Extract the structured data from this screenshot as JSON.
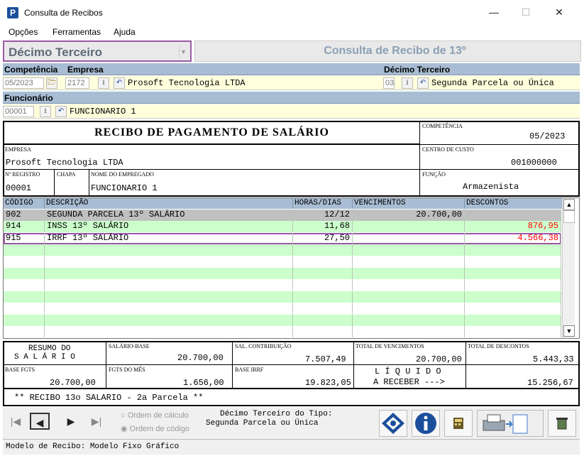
{
  "window": {
    "title": "Consulta de Recibos",
    "app_icon": "P",
    "minimize": "—",
    "maximize": "☐",
    "close": "✕"
  },
  "menu": [
    "Opções",
    "Ferramentas",
    "Ajuda"
  ],
  "combo": {
    "value": "Décimo Terceiro"
  },
  "header": {
    "title": "Consulta de Recibo de 13º"
  },
  "filters": {
    "competencia_label": "Competência",
    "empresa_label": "Empresa",
    "decimo_label": "Décimo Terceiro",
    "competencia_value": "05/2023",
    "empresa_code": "2172",
    "empresa_name": "Prosoft Tecnologia LTDA",
    "decimo_code": "03",
    "decimo_name": "Segunda Parcela ou Única",
    "funcionario_label": "Funcionário",
    "funcionario_code": "00001",
    "funcionario_name": "FUNCIONARIO 1"
  },
  "receipt": {
    "title": "RECIBO DE PAGAMENTO DE SALÁRIO",
    "competencia_label": "COMPETÊNCIA",
    "competencia": "05/2023",
    "empresa_label": "EMPRESA",
    "empresa": "Prosoft Tecnologia LTDA",
    "centro_label": "CENTRO DE CUSTO",
    "centro": "001000000",
    "registro_label": "Nº REGISTRO",
    "registro": "00001",
    "chapa_label": "CHAPA",
    "nome_label": "NOME DO EMPREGADO",
    "nome": "FUNCIONARIO 1",
    "funcao_label": "FUNÇÃO",
    "funcao": "Armazenista"
  },
  "grid": {
    "columns": [
      "CÓDIGO",
      "DESCRIÇÃO",
      "HORAS/DIAS",
      "VENCIMENTOS",
      "DESCONTOS"
    ],
    "rows": [
      {
        "codigo": "902",
        "descricao": "SEGUNDA PARCELA 13º SALÁRIO",
        "horas": "12/12",
        "vencimentos": "20.700,00",
        "descontos": ""
      },
      {
        "codigo": "914",
        "descricao": "INSS 13º SALÁRIO",
        "horas": "11,68",
        "vencimentos": "",
        "descontos": "876,95"
      },
      {
        "codigo": "915",
        "descricao": "IRRF 13º SALÁRIO",
        "horas": "27,50",
        "vencimentos": "",
        "descontos": "4.566,38"
      }
    ],
    "empty_rows": 8,
    "colors": {
      "selected": "#c0c0c0",
      "green": "#ccffcc",
      "desconto": "#ff0000"
    }
  },
  "summary": {
    "resumo_line1": "RESUMO DO",
    "resumo_line2": "S A L Á R I O",
    "salario_base_label": "SALÁRIO-BASE",
    "salario_base": "20.700,00",
    "sal_contrib_label": "SAL. CONTRIBUIÇÃO",
    "sal_contrib": "7.507,49",
    "total_venc_label": "TOTAL DE VENCIMENTOS",
    "total_venc": "20.700,00",
    "total_desc_label": "TOTAL DE DESCONTOS",
    "total_desc": "5.443,33",
    "base_fgts_label": "BASE FGTS",
    "base_fgts": "20.700,00",
    "fgts_mes_label": "FGTS DO MÊS",
    "fgts_mes": "1.656,00",
    "base_irrf_label": "BASE IRRF",
    "base_irrf": "19.823,05",
    "liquido_line1": "L Í Q U I D O",
    "liquido_line2": "A RECEBER --->",
    "liquido": "15.256,67",
    "footnote": "** RECIBO 13o SALARIO - 2a Parcela **"
  },
  "toolbar": {
    "first": "|◀",
    "prev": "◀",
    "next": "▶",
    "last": "▶|",
    "radio1": "Ordem de cálculo",
    "radio2": "Ordem de código",
    "tipo_line1": "Décimo Terceiro do Tipo:",
    "tipo_line2": "Segunda Parcela ou Única"
  },
  "status": {
    "text": "Modelo de Recibo: Modelo Fixo Gráfico"
  }
}
